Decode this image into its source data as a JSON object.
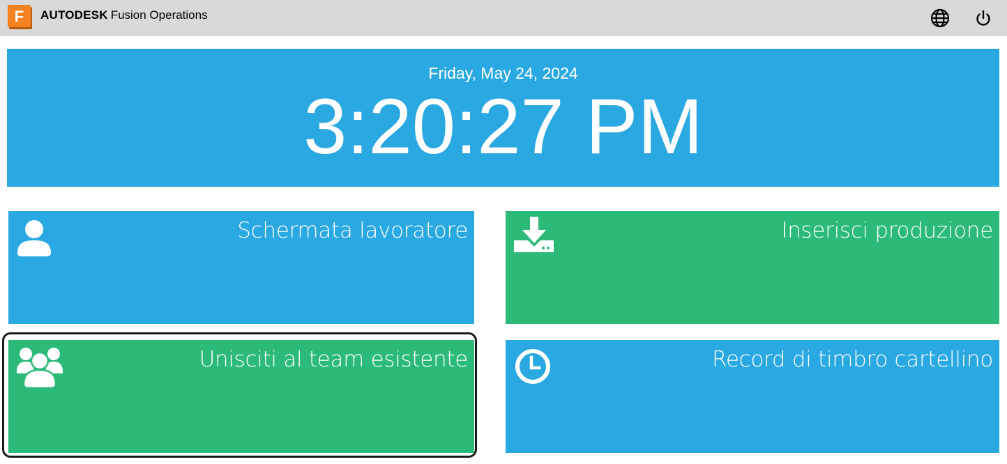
{
  "header": {
    "logo_letter": "F",
    "brand_company": "AUTODESK",
    "brand_product": "Fusion Operations",
    "icons": [
      "globe-icon",
      "power-icon"
    ]
  },
  "clock": {
    "date": "Friday, May 24, 2024",
    "time": "3:20:27 PM"
  },
  "tiles": [
    {
      "label": "Schermata lavoratore",
      "icon": "user-icon",
      "color": "#29a8e2"
    },
    {
      "label": "Inserisci produzione",
      "icon": "download-tray-icon",
      "color": "#2bba78"
    },
    {
      "label": "Unisciti al team esistente",
      "icon": "team-icon",
      "color": "#2bba78",
      "focused": true
    },
    {
      "label": "Record di timbro cartellino",
      "icon": "clock-icon",
      "color": "#29a8e2"
    }
  ],
  "colors": {
    "header_bg": "#d9d9d9",
    "accent_blue": "#29a8e2",
    "accent_green": "#2bba78",
    "logo_orange": "#f58220"
  }
}
